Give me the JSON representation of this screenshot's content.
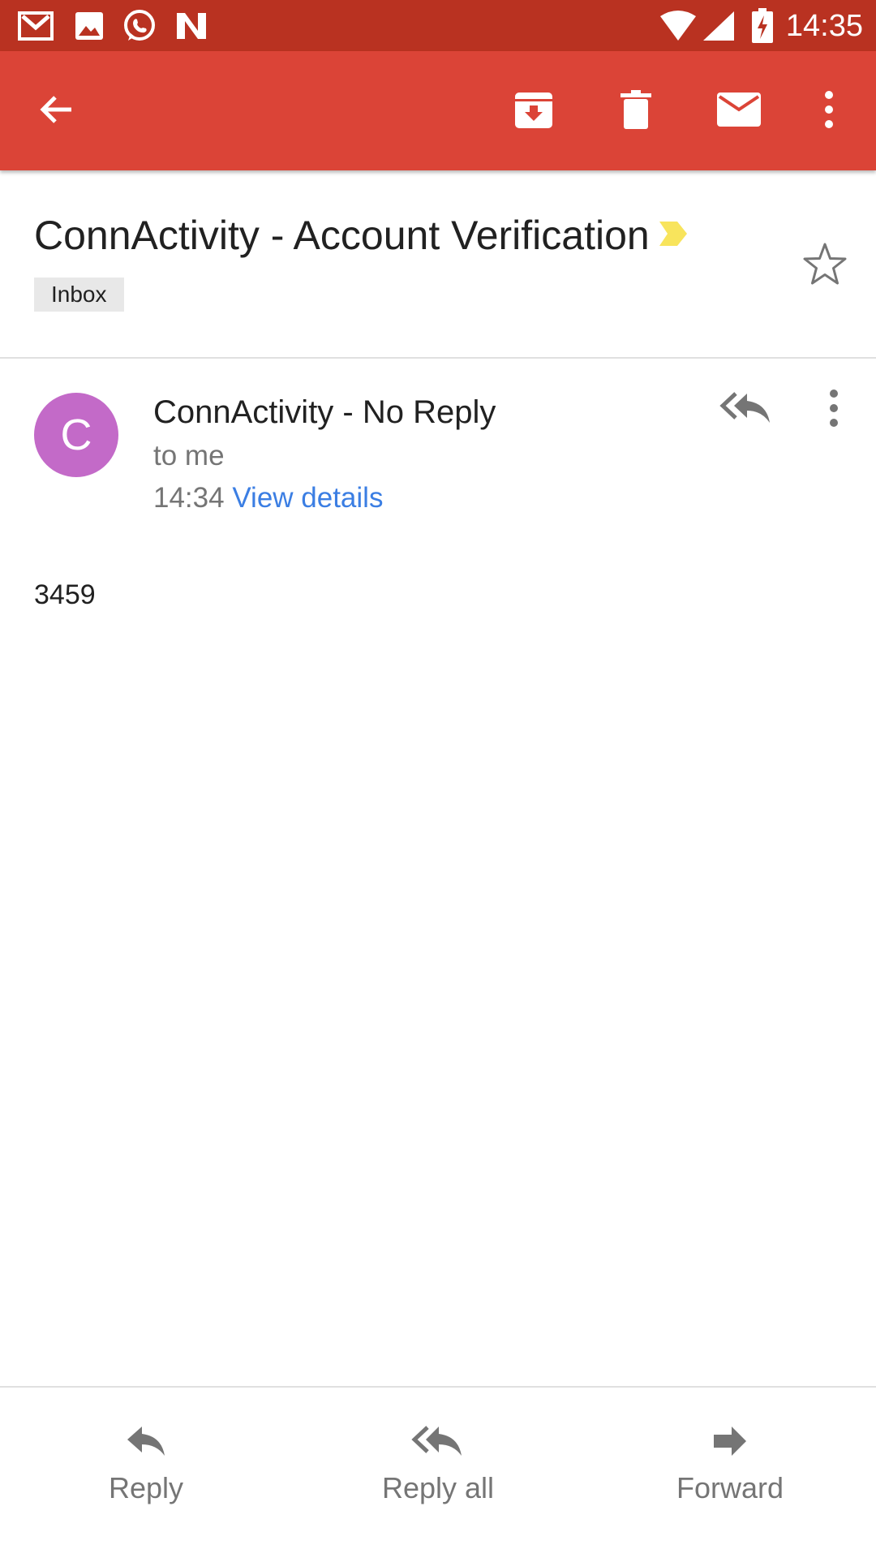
{
  "status_bar": {
    "time": "14:35",
    "notification_icons": [
      "gmail-icon",
      "gallery-icon",
      "whatsapp-icon",
      "n-app-icon"
    ],
    "system_icons": [
      "wifi-icon",
      "signal-icon",
      "battery-charging-icon"
    ],
    "color": "#b93221"
  },
  "app_bar": {
    "color": "#db4437",
    "actions": [
      "back-arrow-icon",
      "archive-icon",
      "delete-icon",
      "mark-unread-icon",
      "more-vert-icon"
    ]
  },
  "email": {
    "subject": "ConnActivity - Account Verification",
    "label": "Inbox",
    "sender_initial": "C",
    "sender": "ConnActivity - No Reply",
    "recipient": "to me",
    "time": "14:34",
    "details_link": "View details",
    "body": "3459",
    "avatar_color": "#c36ac8",
    "link_color": "#3b7ee3"
  },
  "bottom_actions": [
    {
      "label": "Reply",
      "icon": "reply-icon"
    },
    {
      "label": "Reply all",
      "icon": "reply-all-icon"
    },
    {
      "label": "Forward",
      "icon": "forward-icon"
    }
  ]
}
